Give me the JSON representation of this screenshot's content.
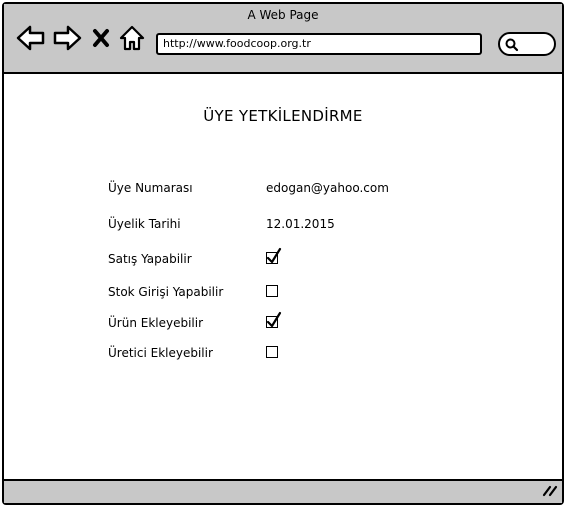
{
  "window": {
    "title": "A Web Page"
  },
  "toolbar": {
    "url": "http://www.foodcoop.org.tr",
    "icons": [
      "back-arrow-icon",
      "forward-arrow-icon",
      "close-icon",
      "home-icon",
      "search-icon"
    ]
  },
  "page": {
    "title": "ÜYE YETKİLENDİRME",
    "fields": [
      {
        "label": "Üye Numarası",
        "value": "edogan@yahoo.com"
      },
      {
        "label": "Üyelik Tarihi",
        "value": "12.01.2015"
      }
    ],
    "permissions": [
      {
        "label": "Satış Yapabilir",
        "checked": true
      },
      {
        "label": "Stok Girişi Yapabilir",
        "checked": false
      },
      {
        "label": "Ürün Ekleyebilir",
        "checked": true
      },
      {
        "label": "Üretici Ekleyebilir",
        "checked": false
      }
    ]
  }
}
